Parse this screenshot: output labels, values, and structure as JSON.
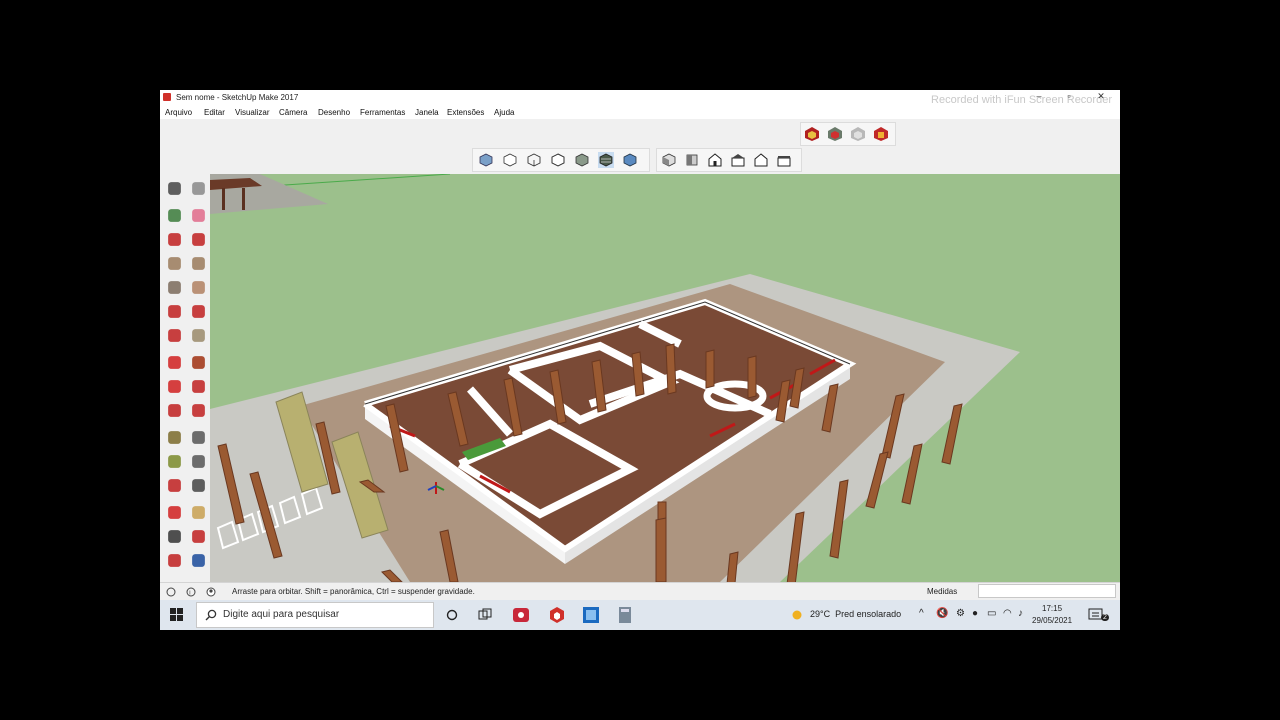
{
  "window": {
    "title": "Sem nome - SketchUp Make 2017",
    "watermark": "Recorded with iFun Screen Recorder",
    "controls": [
      "–",
      "▫",
      "✕"
    ]
  },
  "menu": [
    "Arquivo",
    "Editar",
    "Visualizar",
    "Câmera",
    "Desenho",
    "Ferramentas",
    "Janela",
    "Extensões",
    "Ajuda"
  ],
  "toolbar": {
    "styles_icons": [
      "xray-style-icon",
      "backedges-style-icon",
      "wireframe-style-icon",
      "hiddenline-style-icon",
      "shaded-style-icon",
      "shaded-textures-style-icon",
      "monochrome-style-icon"
    ],
    "views_icons": [
      "iso-view-icon",
      "top-view-icon",
      "front-view-icon",
      "right-view-icon",
      "back-view-icon",
      "left-view-icon"
    ],
    "warehouse_icons": [
      "3d-warehouse-icon",
      "share-model-icon",
      "share-component-icon",
      "extension-warehouse-icon"
    ]
  },
  "left_tools": [
    "select-icon",
    "make-component-icon",
    "paint-bucket-icon",
    "eraser-icon",
    "line-icon",
    "freehand-icon",
    "rectangle-icon",
    "rotated-rectangle-icon",
    "circle-icon",
    "polygon-icon",
    "arc-icon",
    "pie-icon",
    "two-point-arc-icon",
    "three-point-arc-icon",
    "move-icon",
    "push-pull-icon",
    "rotate-icon",
    "follow-me-icon",
    "scale-icon",
    "offset-icon",
    "tape-measure-icon",
    "dimension-icon",
    "protractor-icon",
    "text-icon",
    "axes-icon",
    "3d-text-icon",
    "orbit-icon",
    "pan-icon",
    "zoom-icon",
    "zoom-window-icon",
    "zoom-extents-icon",
    "previous-view-icon"
  ],
  "status": {
    "message": "Arraste para orbitar. Shift = panorâmica, Ctrl = suspender gravidade.",
    "measures_label": "Medidas",
    "measures_value": ""
  },
  "taskbar": {
    "search_placeholder": "Digite aqui para pesquisar",
    "weather": "29°C  Pred ensolarado",
    "time": "17:15",
    "date": "29/05/2021",
    "notification_count": "2"
  },
  "colors": {
    "ground": "#9cc08c",
    "floor": "#7a4a36",
    "walls": "#ffffff",
    "pillars": "#9a5a32",
    "accent_red": "#c01818"
  }
}
